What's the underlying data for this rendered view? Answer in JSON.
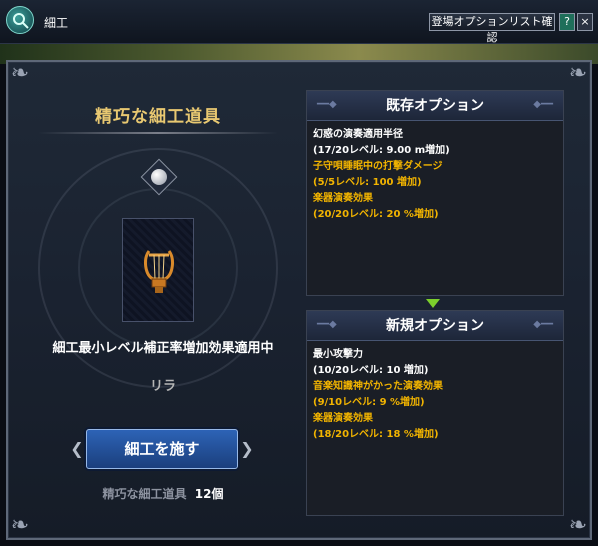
{
  "window": {
    "title": "細工",
    "option_list_button": "登場オプションリスト確認",
    "help_label": "?",
    "close_label": "×"
  },
  "item": {
    "title": "精巧な細工道具",
    "effect_text": "細工最小レベル補正率増加効果適用中",
    "name": "リラ"
  },
  "actions": {
    "craft_label": "細工を施す"
  },
  "material": {
    "name": "精巧な細工道具",
    "count": "12個"
  },
  "existing_options": {
    "header": "既存オプション",
    "lines": [
      "幻惑の演奏適用半径",
      "(17/20レベル: 9.00 m増加)",
      "子守唄睡眠中の打撃ダメージ",
      "(5/5レベル: 100 増加)",
      "楽器演奏効果",
      "(20/20レベル: 20 %増加)"
    ]
  },
  "new_options": {
    "header": "新規オプション",
    "lines": [
      "最小攻撃力",
      "(10/20レベル: 10 増加)",
      "音楽知識神がかった演奏効果",
      "(9/10レベル: 9 %増加)",
      "楽器演奏効果",
      "(18/20レベル: 18 %増加)"
    ]
  },
  "colors": {
    "gold_text": "#f2b400",
    "title_gold": "#e8c871",
    "button_blue": "#2d63b6",
    "arrow_green": "#7ccf2c"
  },
  "icons": [
    "search-icon",
    "lyre-icon",
    "gem-icon",
    "help-icon",
    "close-icon",
    "arrow-down-icon"
  ]
}
